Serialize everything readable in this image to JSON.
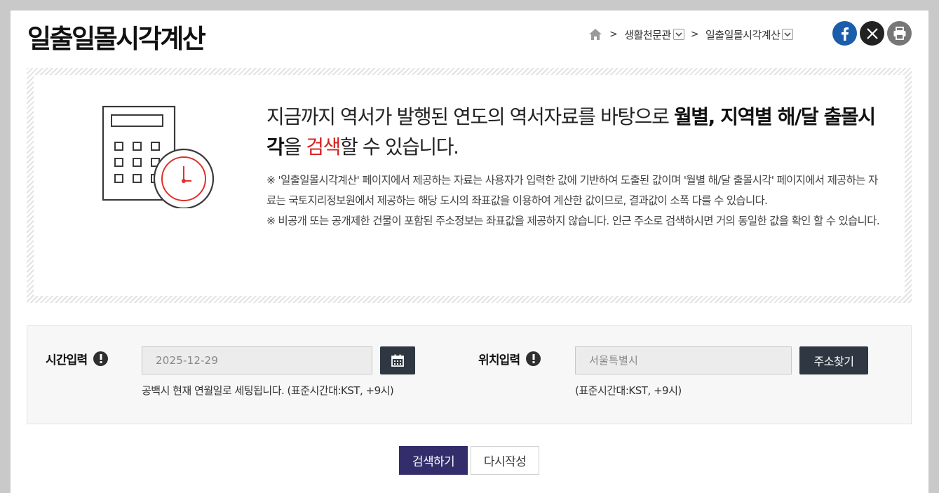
{
  "page": {
    "title": "일출일몰시각계산"
  },
  "breadcrumb": {
    "items": [
      "생활천문관",
      "일출일몰시각계산"
    ],
    "separator": ">"
  },
  "info": {
    "lead_normal": "지금까지 역서가 발행된 연도의 역서자료를 바탕으로 ",
    "lead_bold": "월별, 지역별 해/달 출몰시각",
    "lead_after_bold": "을 ",
    "lead_red": "검색",
    "lead_end": "할 수 있습니다.",
    "note1": "※ '일출일몰시각계산' 페이지에서 제공하는 자료는 사용자가 입력한 값에 기반하여 도출된 값이며 '월별 해/달 출몰시각' 페이지에서 제공하는 자료는 국토지리정보원에서 제공하는 해당 도시의 좌표값을 이용하여 계산한 값이므로, 결과값이 소폭 다를 수 있습니다.",
    "note2": "※ 비공개 또는 공개제한 건물이 포함된 주소정보는 좌표값을 제공하지 않습니다. 인근 주소로 검색하시면 거의 동일한 값을 확인 할 수 있습니다."
  },
  "form": {
    "time_label": "시간입력",
    "date_value": "2025-12-29",
    "date_hint": "공백시 현재 연월일로 세팅됩니다. (표준시간대:KST, +9시)",
    "location_label": "위치입력",
    "location_value": "서울특별시",
    "address_button": "주소찾기",
    "location_hint": "(표준시간대:KST, +9시)"
  },
  "buttons": {
    "search": "검색하기",
    "reset": "다시작성"
  },
  "colors": {
    "primary_button": "#332e6b",
    "dark_button": "#2e3742",
    "highlight": "#d71f1f",
    "facebook": "#1a5daa"
  },
  "icons": [
    "home-icon",
    "chevron-down-icon",
    "facebook-icon",
    "x-icon",
    "print-icon",
    "calculator-clock-icon",
    "exclamation-icon",
    "calendar-icon"
  ]
}
